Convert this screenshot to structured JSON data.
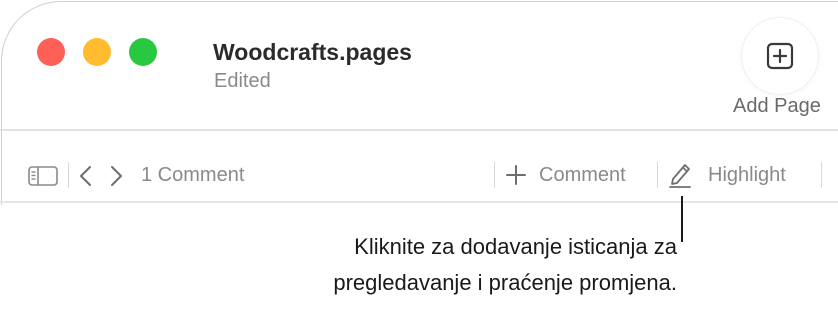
{
  "window": {
    "document_title": "Woodcrafts.pages",
    "document_status": "Edited",
    "controls": {
      "close_color": "#fe5f57",
      "minimize_color": "#febc2e",
      "zoom_color": "#28c840"
    }
  },
  "toolbar": {
    "add_page_label": "Add Page",
    "add_page_icon": "plus-square-icon"
  },
  "comments_bar": {
    "sidebar_toggle_icon": "sidebar-icon",
    "prev_icon": "chevron-left-icon",
    "next_icon": "chevron-right-icon",
    "comment_count_label": "1 Comment",
    "add_comment_label": "Comment",
    "add_comment_icon": "plus-icon",
    "highlight_label": "Highlight",
    "highlight_icon": "pencil-icon"
  },
  "callout": {
    "line1": "Kliknite za dodavanje isticanja za",
    "line2": "pregledavanje i praćenje promjena."
  }
}
